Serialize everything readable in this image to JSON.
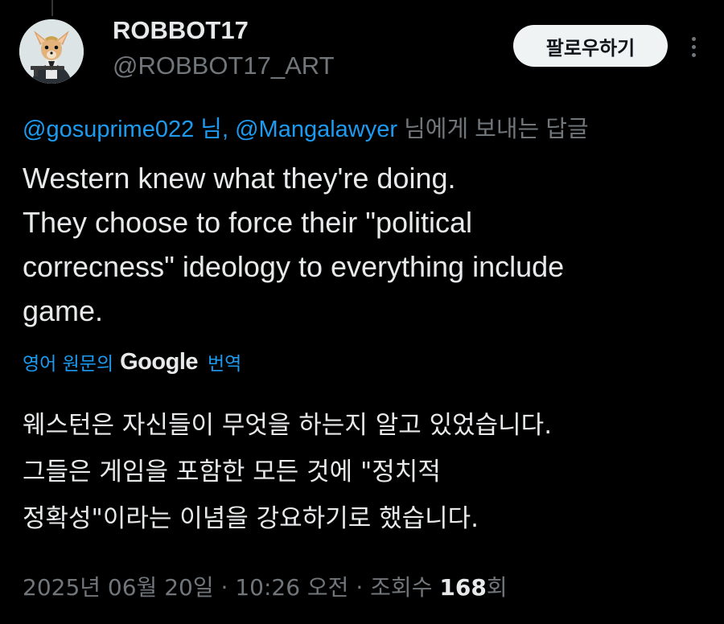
{
  "author": {
    "display_name": "ROBBOT17",
    "handle": "@ROBBOT17_ART"
  },
  "actions": {
    "follow_label": "팔로우하기",
    "more_icon": "more-vertical-icon"
  },
  "reply_context": {
    "mention_1": "@gosuprime022 님",
    "separator": ",",
    "mention_2": "@Mangalawyer",
    "suffix": "님에게 보내는 답글"
  },
  "tweet": {
    "lines": [
      "Western knew what they're doing.",
      "They choose to force their \"political",
      "correcness\" ideology to everything include",
      "game."
    ]
  },
  "translation": {
    "prefix": "영어 원문의",
    "provider": "Google",
    "suffix": "번역",
    "lines": [
      "웨스턴은 자신들이 무엇을 하는지 알고 있었습니다.",
      "그들은 게임을 포함한 모든 것에 \"정치적",
      "정확성\"이라는 이념을 강요하기로 했습니다."
    ]
  },
  "meta": {
    "date": "2025년 06월 20일",
    "sep1": "·",
    "time": "10:26 오전",
    "sep2": "·",
    "views_label": "조회수",
    "views_count": "168",
    "views_suffix": "회"
  },
  "colors": {
    "background": "#000000",
    "text_primary": "#e7e9ea",
    "text_secondary": "#71767b",
    "link_blue": "#1d9bf0",
    "follow_button_bg": "#eff3f4"
  }
}
